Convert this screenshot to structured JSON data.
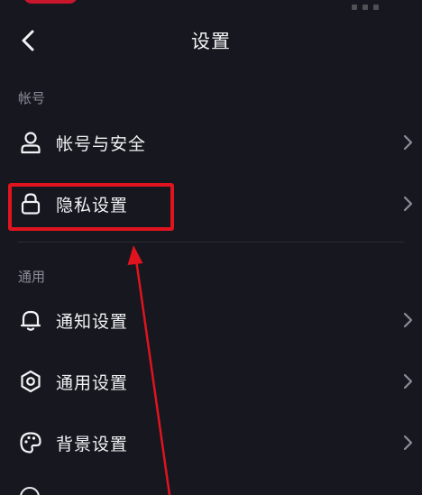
{
  "header": {
    "title": "设置"
  },
  "sections": [
    {
      "label": "帐号",
      "items": [
        {
          "label": "帐号与安全",
          "icon": "user-icon"
        },
        {
          "label": "隐私设置",
          "icon": "lock-icon"
        }
      ]
    },
    {
      "label": "通用",
      "items": [
        {
          "label": "通知设置",
          "icon": "bell-icon"
        },
        {
          "label": "通用设置",
          "icon": "gear-icon"
        },
        {
          "label": "背景设置",
          "icon": "palette-icon"
        }
      ]
    }
  ],
  "annotation": {
    "color": "#e0141f",
    "target": "隐私设置"
  },
  "colors": {
    "background": "#16171f",
    "text": "#f2f2f4",
    "secondary_text": "#8c8d96"
  }
}
